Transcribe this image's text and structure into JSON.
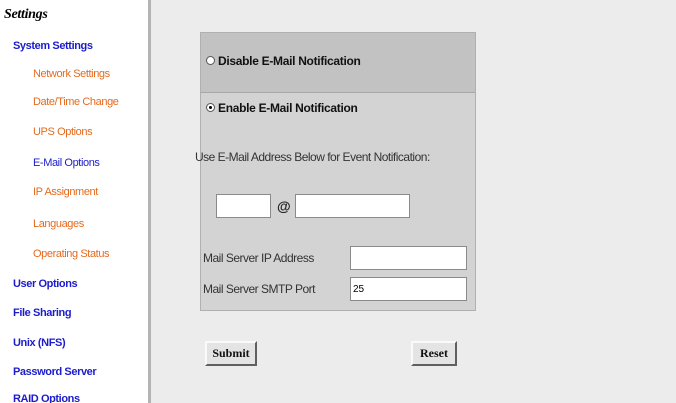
{
  "sidebar": {
    "title": "Settings",
    "items": [
      {
        "label": "System Settings",
        "type": "section"
      },
      {
        "label": "Network Settings",
        "type": "sub"
      },
      {
        "label": "Date/Time Change",
        "type": "sub"
      },
      {
        "label": "UPS Options",
        "type": "sub"
      },
      {
        "label": "E-Mail Options",
        "type": "sub",
        "active": true
      },
      {
        "label": "IP Assignment",
        "type": "sub"
      },
      {
        "label": "Languages",
        "type": "sub"
      },
      {
        "label": "Operating Status",
        "type": "sub"
      },
      {
        "label": "User Options",
        "type": "section"
      },
      {
        "label": "File Sharing",
        "type": "section"
      },
      {
        "label": "Unix (NFS)",
        "type": "section"
      },
      {
        "label": "Password Server",
        "type": "section"
      },
      {
        "label": "RAID Options",
        "type": "section"
      }
    ]
  },
  "form": {
    "disable_label": "Disable E-Mail Notification",
    "enable_label": "Enable E-Mail Notification",
    "selected": "enable",
    "instruction": "Use E-Mail Address Below for Event Notification:",
    "email_user_value": "",
    "at_symbol": "@",
    "email_domain_value": "",
    "mail_server_ip_label": "Mail Server IP Address",
    "mail_server_ip_value": "",
    "smtp_port_label": "Mail Server SMTP Port",
    "smtp_port_value": "25"
  },
  "buttons": {
    "submit_label": "Submit",
    "reset_label": "Reset"
  },
  "colors": {
    "section_link": "#1c1ccc",
    "sub_link": "#e56a1d",
    "panel_bg": "#d3d3d3"
  }
}
